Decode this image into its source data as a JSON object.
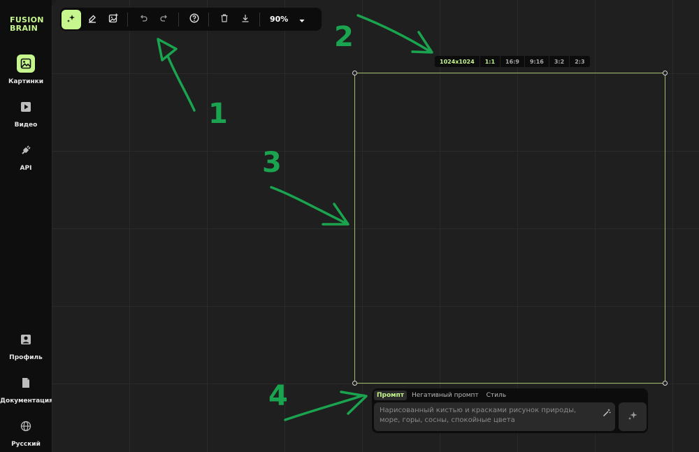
{
  "brand": {
    "logo_line1": "FUSION",
    "logo_line2": "BRAIN",
    "accent": "#c6f68d"
  },
  "sidebar": {
    "items": [
      {
        "label": "Картинки",
        "icon": "image-icon",
        "active": true
      },
      {
        "label": "Видео",
        "icon": "video-icon"
      },
      {
        "label": "API",
        "icon": "api-plug-icon"
      },
      {
        "label": "Профиль",
        "icon": "profile-icon"
      },
      {
        "label": "Документация",
        "icon": "document-icon"
      },
      {
        "label": "Русский",
        "icon": "globe-icon"
      }
    ]
  },
  "toolbar": {
    "tools": [
      "generate-tool-icon",
      "eraser-tool-icon",
      "image-upload-icon"
    ],
    "history": [
      "undo-icon",
      "redo-icon"
    ],
    "misc": [
      "help-icon",
      "delete-icon",
      "download-icon"
    ],
    "zoom": "90%"
  },
  "size_tabs": [
    "1024x1024",
    "1:1",
    "16:9",
    "9:16",
    "3:2",
    "2:3"
  ],
  "prompt": {
    "tabs": [
      "Промпт",
      "Негативный промпт",
      "Стиль"
    ],
    "placeholder": "Нарисованный кистью и красками рисунок природы, море, горы, сосны, спокойные цвета"
  },
  "annotations": [
    "1",
    "2",
    "3",
    "4"
  ],
  "colors": {
    "annotation_green": "#1aa44f",
    "frame_border": "#9fbd6a"
  }
}
